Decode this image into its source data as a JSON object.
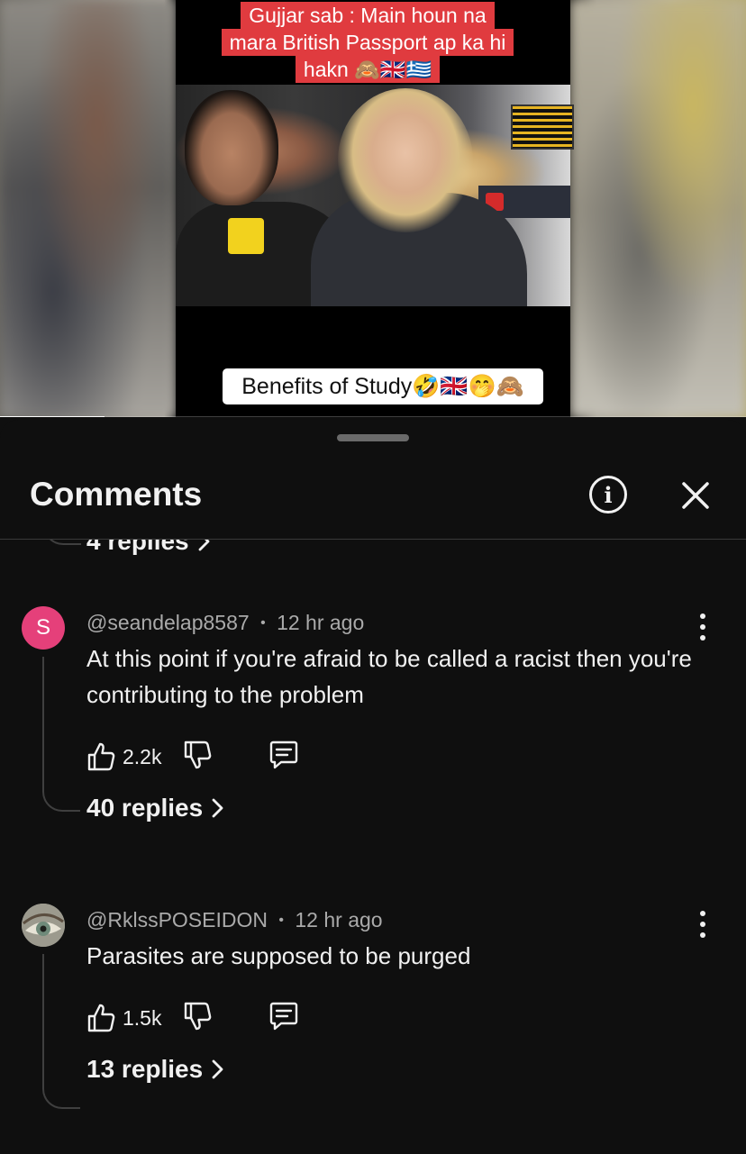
{
  "video": {
    "caption_top_lines": [
      "Gujjar sab : Main houn na",
      "mara British Passport ap ka hi",
      "hakn 🙈🇬🇧🇬🇷"
    ],
    "caption_bottom": "Benefits of Study🤣🇬🇧🤭🙈",
    "progress_fraction": 0.14
  },
  "sheet": {
    "title": "Comments",
    "info_icon": "info-circle-icon",
    "close_icon": "close-icon"
  },
  "previous_thread": {
    "replies_label": "4 replies"
  },
  "comments": [
    {
      "avatar_letter": "S",
      "avatar_color": "#e5407a",
      "author": "@seandelap8587",
      "time": "12 hr ago",
      "text": "At this point if you're afraid to be called a racist then you're contributing to the problem",
      "likes": "2.2k",
      "replies_label": "40 replies"
    },
    {
      "avatar_letter": "",
      "avatar_color": "#9fa39a",
      "author": "@RklssPOSEIDON",
      "time": "12 hr ago",
      "text": "Parasites are supposed to be purged",
      "likes": "1.5k",
      "replies_label": "13 replies"
    }
  ],
  "separator": "•",
  "colors": {
    "background": "#0f0f0f",
    "text": "#f1f1f1",
    "meta_text": "#aaaaaa",
    "caption_red": "#e03b3f"
  }
}
